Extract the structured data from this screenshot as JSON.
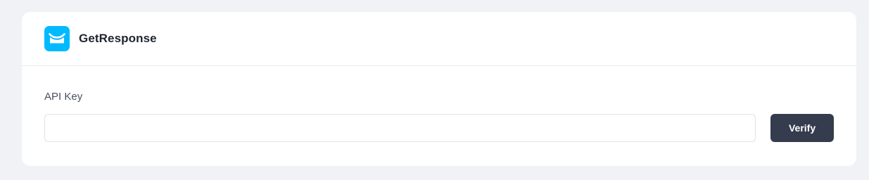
{
  "integration": {
    "name": "GetResponse",
    "logo_icon": "getresponse-envelope-icon",
    "brand_color": "#00baff"
  },
  "form": {
    "api_key_label": "API Key",
    "api_key_value": "",
    "api_key_placeholder": "",
    "verify_label": "Verify",
    "button_color": "#343c4d"
  }
}
